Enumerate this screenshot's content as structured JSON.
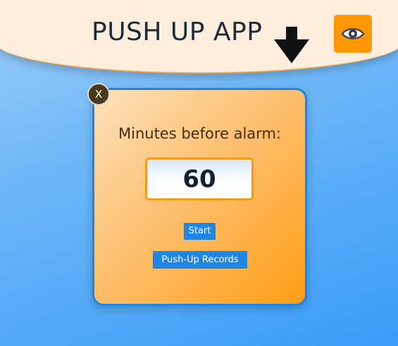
{
  "header": {
    "title": "PUSH UP APP",
    "arrow_icon": "arrow-down-icon",
    "eye_button_icon": "eye-icon"
  },
  "timer_card": {
    "close_label": "X",
    "minutes_label": "Minutes before alarm:",
    "minutes_value": "60",
    "start_label": "Start",
    "records_label": "Push-Up Records"
  },
  "colors": {
    "accent_orange": "#ff9800",
    "button_blue": "#1e86e8",
    "header_cream": "#fdeede",
    "title_dark": "#1d2b3a"
  }
}
